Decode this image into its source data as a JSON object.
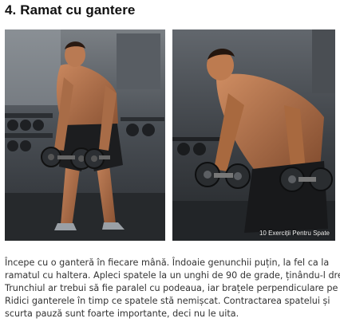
{
  "article": {
    "heading": "4. Ramat cu gantere",
    "images": [
      {
        "icon": "gym-exercise-photo-front"
      },
      {
        "icon": "gym-exercise-photo-side",
        "caption": "10 Exerciții Pentru Spate"
      }
    ],
    "description_lines": [
      "Începe cu o ganteră în fiecare mână. Îndoaie genunchii puțin, la fel ca la",
      "ramatul cu haltera. Apleci spatele la un unghi de 90 de grade, ținându-l drept.",
      "Trunchiul ar trebui să fie paralel cu podeaua, iar brațele perpendiculare pe ea.",
      "Ridici ganterele în timp ce spatele stă nemișcat. Contractarea spatelui și",
      "scurta pauză sunt foarte importante, deci nu le uita."
    ]
  }
}
